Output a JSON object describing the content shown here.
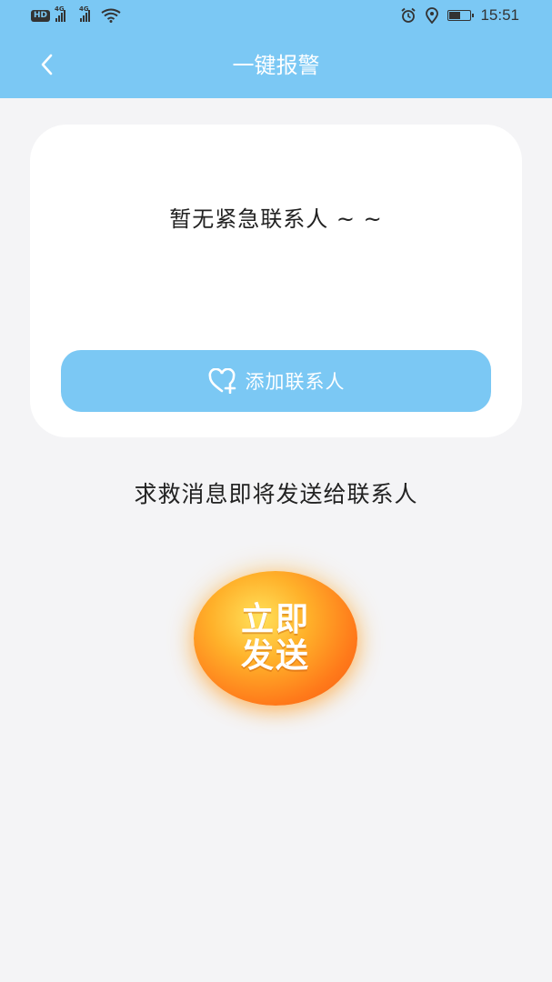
{
  "status_bar": {
    "hd_label": "HD",
    "network_1": "4G",
    "network_2": "4G",
    "time": "15:51",
    "battery_level": 0.5,
    "icons": [
      "hd-icon",
      "signal-icon",
      "signal-icon",
      "wifi-icon",
      "alarm-icon",
      "location-icon",
      "battery-icon"
    ]
  },
  "header": {
    "title": "一键报警",
    "back_icon": "chevron-left-icon"
  },
  "contacts_card": {
    "empty_text": "暂无紧急联系人 ~ ~",
    "add_button_label": "添加联系人",
    "add_button_icon": "heart-plus-icon"
  },
  "hint_text": "求救消息即将发送给联系人",
  "send_button": {
    "line1": "立即",
    "line2": "发送"
  },
  "colors": {
    "accent": "#7bc8f4",
    "background": "#f4f4f6",
    "send_gradient_start": "#ffe15a",
    "send_gradient_end": "#f55a12"
  }
}
